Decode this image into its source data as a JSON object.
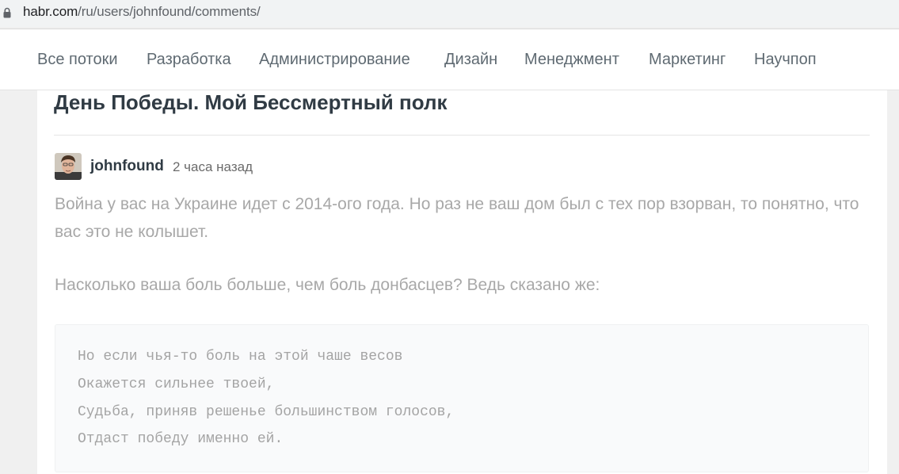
{
  "browser": {
    "url_domain": "habr.com",
    "url_path": "/ru/users/johnfound/comments/",
    "lock_icon": "lock-icon"
  },
  "nav": {
    "items": [
      {
        "label": "Все потоки"
      },
      {
        "label": "Разработка"
      },
      {
        "label": "Администрирование"
      },
      {
        "label": "Дизайн"
      },
      {
        "label": "Менеджмент"
      },
      {
        "label": "Маркетинг"
      },
      {
        "label": "Научпоп"
      }
    ]
  },
  "post": {
    "title": "День Победы. Мой Бессмертный полк"
  },
  "comment": {
    "author": "johnfound",
    "time": "2 часа назад",
    "paragraphs": [
      "Война у вас на Украине идет с 2014-ого года. Но раз не ваш дом был с тех пор взорван, то понятно, что вас это не колышет.",
      "Насколько ваша боль больше, чем боль донбасцев? Ведь сказано же:"
    ],
    "quote_lines": [
      "Но если чья-то боль на этой чаше весов",
      "Окажется сильнее твоей,",
      "Судьба, приняв решенье большинством голосов,",
      "Отдаст победу именно ей."
    ]
  },
  "colors": {
    "nav_text": "#5f6a72",
    "title_text": "#303b44",
    "comment_text": "#a8a8a8",
    "quote_bg": "#f9fafb"
  }
}
